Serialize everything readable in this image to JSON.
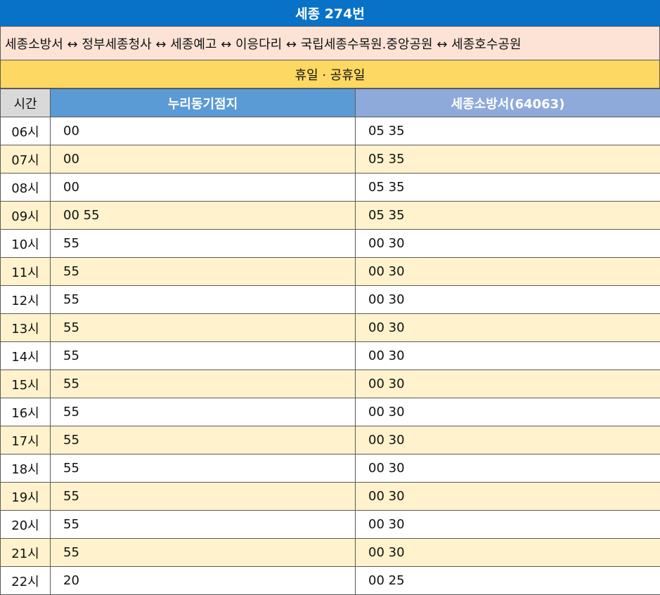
{
  "title": "세종 274번",
  "route": "세종소방서 ↔ 정부세종청사 ↔ 세종예고 ↔ 이응다리 ↔ 국립세종수목원.중앙공원 ↔ 세종호수공원",
  "day_type": "휴일 · 공휴일",
  "headers": {
    "time": "시간",
    "stop_a": "누리동기점지",
    "stop_b": "세종소방서(64063)"
  },
  "colors": {
    "title_bg": "#0872c9",
    "route_bg": "#fde3d6",
    "day_bg": "#fdd862",
    "header_a": "#5b9bd5",
    "header_b": "#8eaadb",
    "alt_row": "#fff2cc"
  },
  "rows": [
    {
      "hour": "06시",
      "a": "00",
      "b": "05 35"
    },
    {
      "hour": "07시",
      "a": "00",
      "b": "05 35"
    },
    {
      "hour": "08시",
      "a": "00",
      "b": "05 35"
    },
    {
      "hour": "09시",
      "a": "00 55",
      "b": "05 35"
    },
    {
      "hour": "10시",
      "a": "55",
      "b": "00 30"
    },
    {
      "hour": "11시",
      "a": "55",
      "b": "00 30"
    },
    {
      "hour": "12시",
      "a": "55",
      "b": "00 30"
    },
    {
      "hour": "13시",
      "a": "55",
      "b": "00 30"
    },
    {
      "hour": "14시",
      "a": "55",
      "b": "00 30"
    },
    {
      "hour": "15시",
      "a": "55",
      "b": "00 30"
    },
    {
      "hour": "16시",
      "a": "55",
      "b": "00 30"
    },
    {
      "hour": "17시",
      "a": "55",
      "b": "00 30"
    },
    {
      "hour": "18시",
      "a": "55",
      "b": "00 30"
    },
    {
      "hour": "19시",
      "a": "55",
      "b": "00 30"
    },
    {
      "hour": "20시",
      "a": "55",
      "b": "00 30"
    },
    {
      "hour": "21시",
      "a": "55",
      "b": "00 30"
    },
    {
      "hour": "22시",
      "a": "20",
      "b": "00 25"
    }
  ]
}
